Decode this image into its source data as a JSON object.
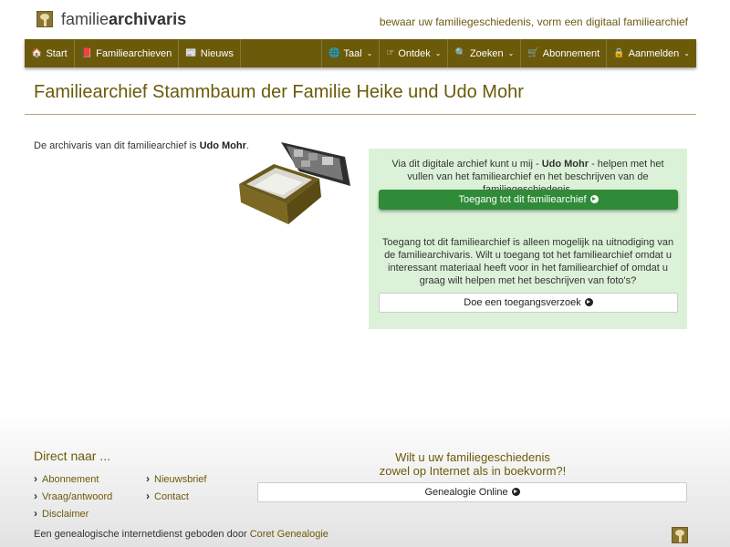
{
  "brand": {
    "name_light": "familie",
    "name_bold": "archivaris",
    "tagline": "bewaar uw familiegeschiedenis, vorm een digitaal familiearchief"
  },
  "nav": {
    "left": [
      {
        "label": "Start",
        "icon": "home-icon",
        "glyph": "🏠"
      },
      {
        "label": "Familiearchieven",
        "icon": "book-icon",
        "glyph": "📕"
      },
      {
        "label": "Nieuws",
        "icon": "newspaper-icon",
        "glyph": "📰"
      }
    ],
    "right": [
      {
        "label": "Taal",
        "icon": "language-icon",
        "glyph": "🌐"
      },
      {
        "label": "Ontdek",
        "icon": "pointer-icon",
        "glyph": "☞"
      },
      {
        "label": "Zoeken",
        "icon": "search-icon",
        "glyph": "🔍"
      },
      {
        "label": "Abonnement",
        "icon": "cart-icon",
        "glyph": "🛒"
      },
      {
        "label": "Aanmelden",
        "icon": "lock-icon",
        "glyph": "🔒"
      }
    ]
  },
  "page": {
    "title": "Familiearchief Stammbaum der Familie Heike und Udo Mohr",
    "owner_prefix": "De archivaris van dit familiearchief is ",
    "owner_name": "Udo Mohr",
    "owner_suffix": "."
  },
  "access": {
    "text1_prefix": "Via dit digitale archief kunt u mij - ",
    "text1_name": "Udo Mohr",
    "text1_suffix": " - helpen met het vullen van het familiearchief en het beschrijven van de familiegeschiedenis.",
    "button1": "Toegang tot dit familiearchief",
    "text2": "Toegang tot dit familiearchief is alleen mogelijk na uitnodiging van de familiearchivaris. Wilt u toegang tot het familiearchief omdat u interessant materiaal heeft voor in het familiearchief of omdat u graag wilt helpen met het beschrijven van foto's?",
    "button2": "Doe een toegangsverzoek"
  },
  "footer": {
    "title": "Direct naar ...",
    "links": [
      "Abonnement",
      "Nieuwsbrief",
      "Vraag/antwoord",
      "Contact",
      "Disclaimer"
    ],
    "promo_line1": "Wilt u uw familiegeschiedenis",
    "promo_line2": "zowel op Internet als in boekvorm?!",
    "promo_button": "Genealogie Online",
    "credit_prefix": "Een genealogische internetdienst geboden door ",
    "credit_link": "Coret Genealogie"
  }
}
